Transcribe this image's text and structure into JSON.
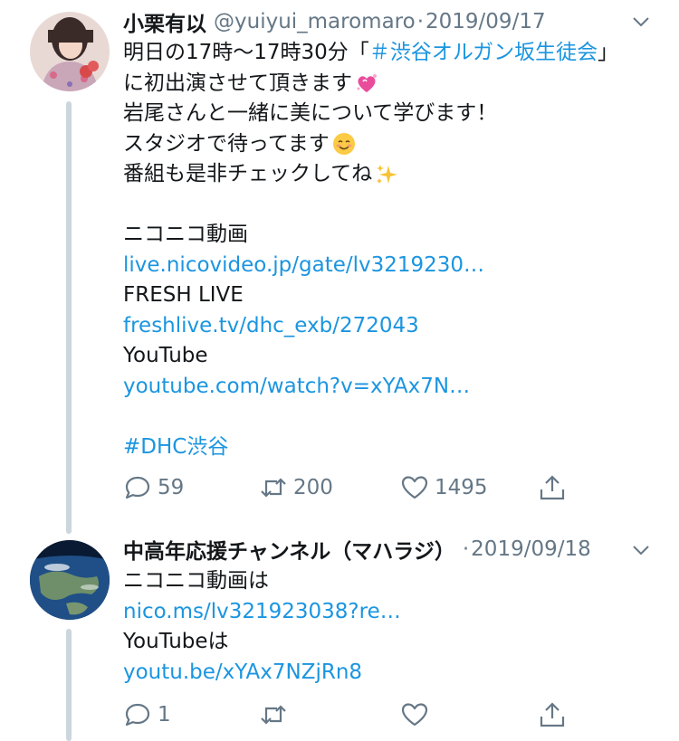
{
  "tweets": [
    {
      "display_name": "小栗有以",
      "handle": "@yuiyui_maromaro",
      "separator": "·",
      "date": "2019/09/17",
      "lines": {
        "l1_prefix": "明日の17時〜17時30分「",
        "l1_hashtag": "＃渋谷オルガン坂生徒会",
        "l1_suffix": "」",
        "l2": "に初出演させて頂きます",
        "l3": "岩尾さんと一緒に美について学びます！",
        "l4": "スタジオで待ってます",
        "l5": "番組も是非チェックしてね",
        "l6": "ニコニコ動画",
        "l7_link": "live.nicovideo.jp/gate/lv3219230…",
        "l8": "FRESH LIVE",
        "l9_link": "freshlive.tv/dhc_exb/272043",
        "l10": "YouTube",
        "l11_link": "youtube.com/watch?v=xYAx7N…",
        "l12_hashtag": "#DHC渋谷"
      },
      "emojis": [
        "sparkling-heart-emoji",
        "smiling-face-emoji",
        "sparkles-emoji"
      ],
      "actions": {
        "replies": "59",
        "retweets": "200",
        "likes": "1495"
      }
    },
    {
      "display_name": "中高年応援チャンネル（マハラジ）",
      "separator": "·",
      "date": "2019/09/18",
      "lines": {
        "l1": "ニコニコ動画は",
        "l2_link": "nico.ms/lv321923038?re…",
        "l3": "YouTubeは",
        "l4_link": "youtu.be/xYAx7NZjRn8"
      },
      "actions": {
        "replies": "1",
        "retweets": "",
        "likes": ""
      }
    }
  ],
  "colors": {
    "link": "#1b95e0",
    "secondary": "#657786",
    "thread_line": "#ccd6dd"
  }
}
